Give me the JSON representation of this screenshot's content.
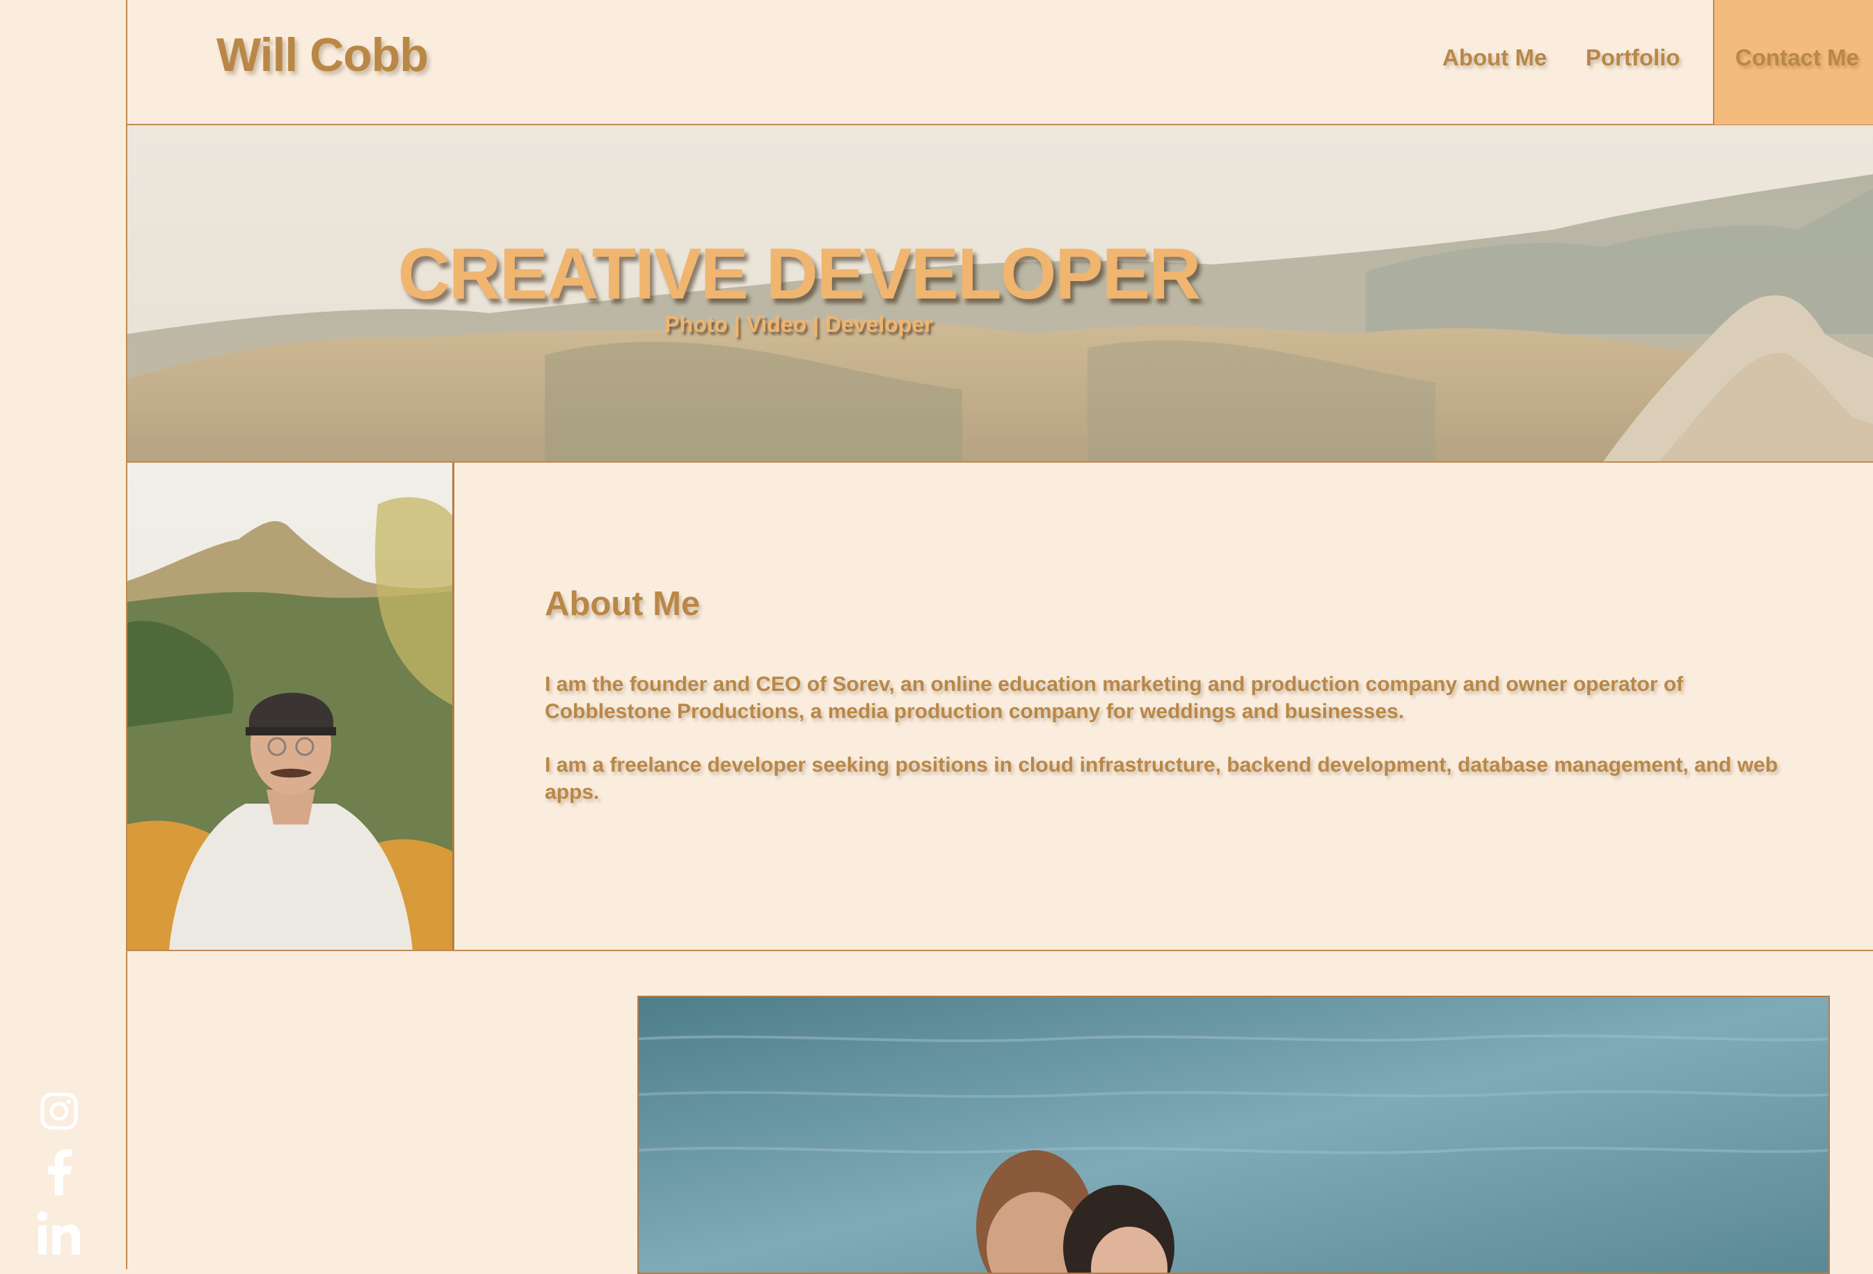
{
  "brand": {
    "name": "Will Cobb"
  },
  "nav": {
    "about": "About Me",
    "portfolio": "Portfolio",
    "contact": "Contact Me"
  },
  "hero": {
    "title": "CREATIVE DEVELOPER",
    "subtitle": "Photo | Video | Developer"
  },
  "about": {
    "heading": "About Me",
    "paragraphs": [
      "I am the founder and CEO of Sorev, an online education marketing and production company and owner operator of Cobblestone Productions, a media production company for weddings and businesses.",
      "I am a freelance developer seeking positions in cloud infrastructure, backend development, database management, and web apps."
    ]
  },
  "social": [
    "instagram-icon",
    "facebook-icon",
    "linkedin-icon"
  ],
  "colors": {
    "background": "#faedde",
    "accent": "#b98746",
    "contact_bg": "#f4bc7c",
    "hero_text": "#f0b56f",
    "border": "#c08a52"
  }
}
